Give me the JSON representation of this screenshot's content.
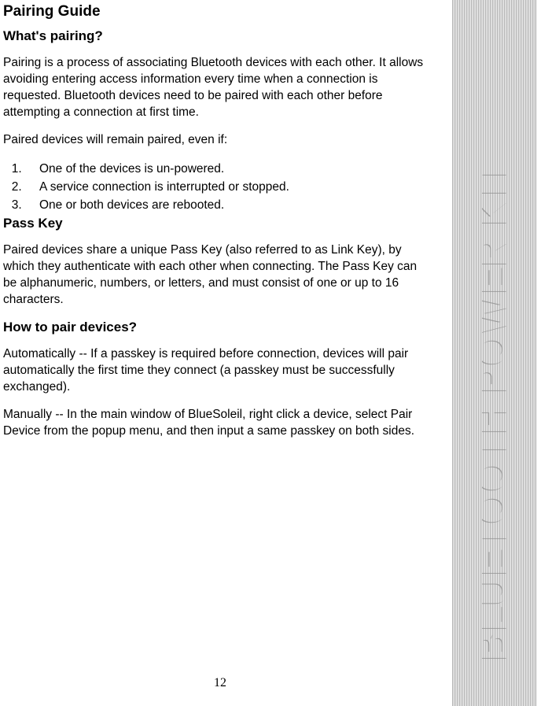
{
  "title": "Pairing Guide",
  "sections": {
    "whats_pairing": {
      "heading": "What's pairing?",
      "para1": "Pairing is a process of associating Bluetooth devices with each other. It allows avoiding entering access information every time when a connection is requested. Bluetooth devices need to be paired with each other before attempting a connection at first time.",
      "para2": "Paired devices will remain paired, even if:",
      "list": [
        "One of the devices is un-powered.",
        "A service connection is interrupted or stopped.",
        "One or both devices are rebooted."
      ]
    },
    "pass_key": {
      "heading": "Pass Key",
      "para1": "Paired devices share a unique Pass Key (also referred to as Link Key), by which they authenticate with each other when connecting. The Pass Key can be alphanumeric, numbers, or letters, and must consist of one or up to 16 characters."
    },
    "how_to_pair": {
      "heading": "How to pair devices?",
      "para1": "Automatically -- If a passkey is required before connection, devices will pair automatically the first time they connect (a passkey must be successfully exchanged).",
      "para2": "Manually -- In the main window of BlueSoleil, right click a device, select Pair Device from the popup menu, and then input a same passkey on both sides."
    }
  },
  "page_number": "12",
  "sidebar_text": "BLUETOOTH POWER KIT"
}
